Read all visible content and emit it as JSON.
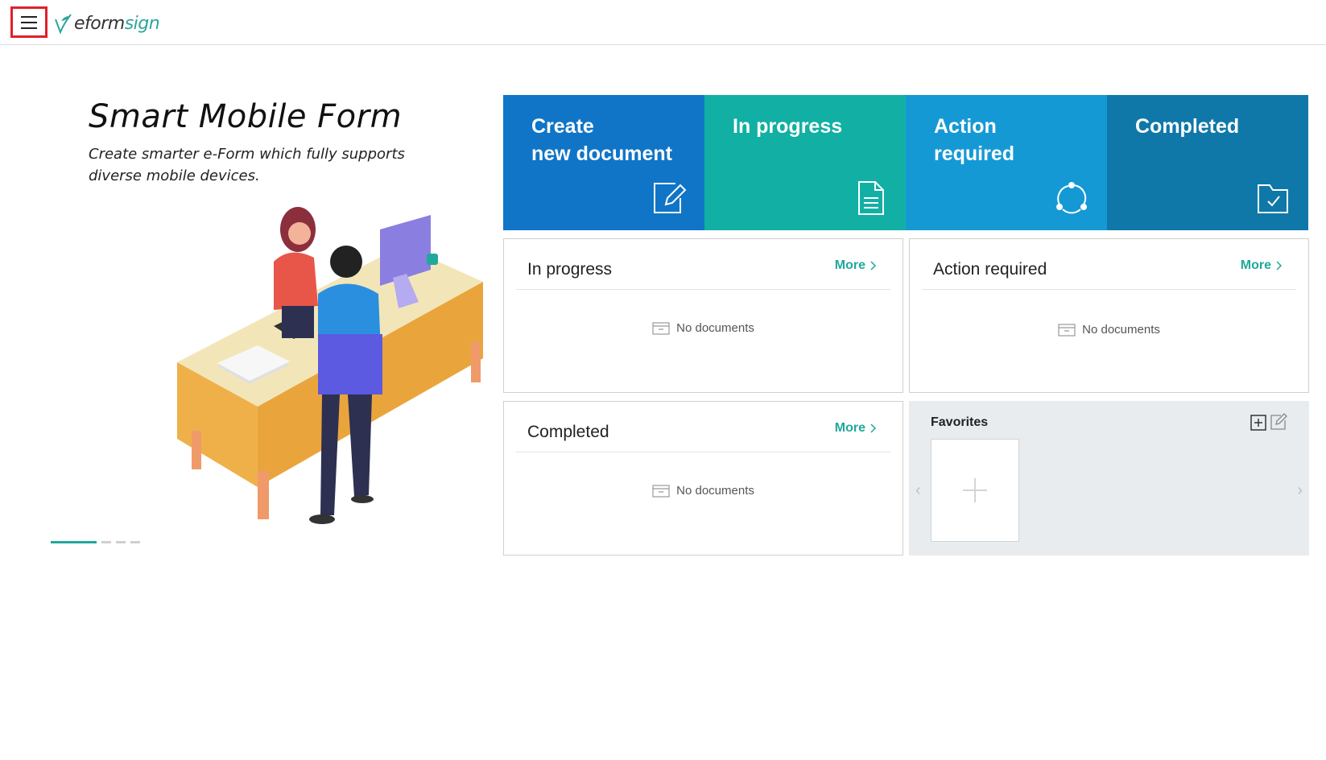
{
  "header": {
    "menu_icon": "hamburger-menu-icon",
    "logo": {
      "part1": "eform",
      "part2": "sign",
      "accent": "#2aa59a"
    }
  },
  "hero": {
    "title": "Smart Mobile Form",
    "subtitle": "Create smarter e-Form which fully supports diverse mobile devices.",
    "carousel": {
      "total": 4,
      "active": 1
    }
  },
  "tiles": [
    {
      "label": "Create\nnew document",
      "icon": "edit-document-icon",
      "color": "#1075c6"
    },
    {
      "label": "In progress",
      "icon": "document-icon",
      "color": "#12b0a4"
    },
    {
      "label": "Action\nrequired",
      "icon": "cycle-icon",
      "color": "#1599d5"
    },
    {
      "label": "Completed",
      "icon": "folder-check-icon",
      "color": "#0f78a8"
    }
  ],
  "panels": {
    "in_progress": {
      "title": "In progress",
      "more": "More",
      "empty": "No documents"
    },
    "action_required": {
      "title": "Action required",
      "more": "More",
      "empty": "No documents"
    },
    "completed": {
      "title": "Completed",
      "more": "More",
      "empty": "No documents"
    }
  },
  "favorites": {
    "title": "Favorites",
    "add_icon": "plus-square-icon",
    "edit_icon": "edit-icon"
  },
  "colors": {
    "accent": "#20a89c",
    "highlight": "#e0202a"
  }
}
